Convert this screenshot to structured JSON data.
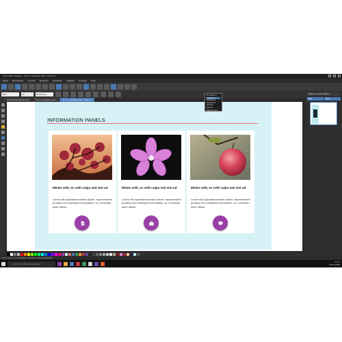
{
  "window": {
    "title": "Xara Web Designer - [Touch_website.web * [Menu]]"
  },
  "menu": [
    "Datei",
    "Bearbeiten",
    "Ansicht",
    "Einfügen",
    "Gestalten",
    "Objekte",
    "Arrange",
    "Hilfe"
  ],
  "toolbar2": {
    "font_value": "Lato",
    "style_value": "Heading 3",
    "size_value": "22"
  },
  "document_tabs": [
    "websitetemplate.web",
    "Touch_website.web",
    "Touch_website.web * [Menu]"
  ],
  "page": {
    "heading": "INFORMATION PANELS",
    "cards": [
      {
        "title": "Minim velit, ex velit culpa sed sint ad",
        "body": "Lorem elit cupidatat molestie dolore, reprehenderit proident non incididunt exercitation. Ut, commodo dolor officia ."
      },
      {
        "title": "Minim velit, ex velit culpa sed sint ad",
        "body": "Lorem elit cupidatat molestie dolore, reprehenderit proident non incididunt exercitation. Ut, commodo dolor officia."
      },
      {
        "title": "Minim velit, ex velit culpa sed sint ad",
        "body": "Lorem elit cupidatat molestie dolore, reprehenderit proident non incididunt exercitation. Ut, commodo dolor officia ."
      }
    ]
  },
  "dropdown": {
    "items": [
      "No Spacing",
      "Heading 1",
      "Heading 2",
      "Heading 3",
      "Default",
      "Normal",
      "Regular text"
    ],
    "selected_index": 1
  },
  "right_panel": {
    "header": "Page & Layer gallery",
    "tabs": [
      "Page",
      "Layer"
    ]
  },
  "status": {
    "text": "1 text cursor (17 characters, 2 words) on layer MouseOff"
  },
  "taskbar": {
    "search_placeholder": "Zur Suche Text hier eingeben",
    "time": "14:37",
    "date": "20.09.2018"
  },
  "colors": {
    "accent": "#9b3fa8",
    "panel_bg": "#d6f2f6",
    "heading_rule": "#e0707a",
    "ui_blue": "#4a79b6"
  },
  "icons": {
    "card1_button": "document-icon",
    "card2_button": "briefcase-icon",
    "card3_button": "chat-bubble-icon"
  }
}
